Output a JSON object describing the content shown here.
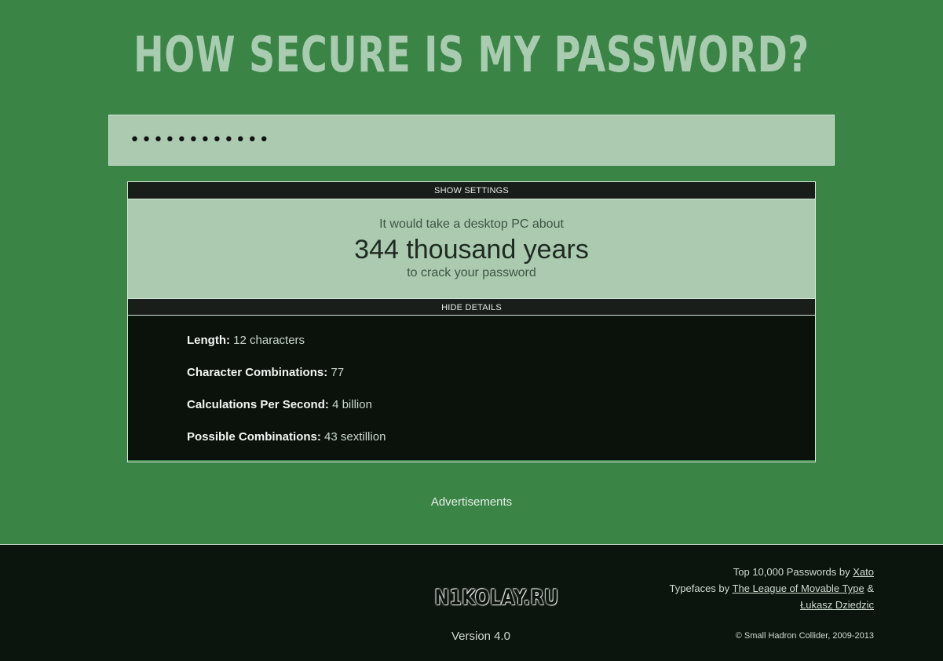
{
  "header": {
    "title": "HOW SECURE IS MY PASSWORD?"
  },
  "password": {
    "value": "••••••••••••",
    "length": 12
  },
  "settings_toggle": "SHOW SETTINGS",
  "result": {
    "pre": "It would take a desktop PC about",
    "time": "344 thousand years",
    "post": "to crack your password"
  },
  "details_toggle": "HIDE DETAILS",
  "details": [
    {
      "label": "Length:",
      "value": "12 characters"
    },
    {
      "label": "Character Combinations:",
      "value": "77"
    },
    {
      "label": "Calculations Per Second:",
      "value": "4 billion"
    },
    {
      "label": "Possible Combinations:",
      "value": "43 sextillion"
    }
  ],
  "ads_label": "Advertisements",
  "footer": {
    "logo": "N1KOLAY.RU",
    "version": "Version 4.0",
    "credits": {
      "line1_prefix": "Top 10,000 Passwords by",
      "line1_link": "Xato",
      "line2_prefix": "Typefaces by",
      "line2_link": "The League of Movable Type",
      "line2_suffix": "&",
      "line3_link": "Łukasz Dziedzic"
    },
    "copyright": "© Small Hadron Collider, 2009-2013"
  },
  "colors": {
    "background": "#3a8446",
    "title": "#a9cbb0",
    "panel_light": "#abcab0",
    "panel_dark": "#0b120c"
  }
}
